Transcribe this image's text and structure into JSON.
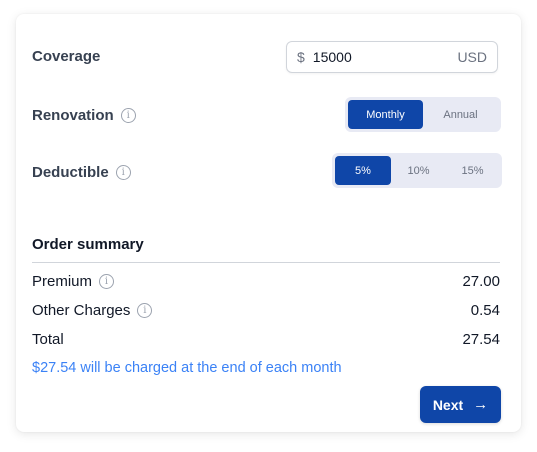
{
  "coverage": {
    "label": "Coverage",
    "prefix": "$",
    "value": "15000",
    "suffix": "USD"
  },
  "renovation": {
    "label": "Renovation",
    "options": [
      "Monthly",
      "Annual"
    ],
    "selected": "Monthly"
  },
  "deductible": {
    "label": "Deductible",
    "options": [
      "5%",
      "10%",
      "15%"
    ],
    "selected": "5%"
  },
  "summary": {
    "title": "Order summary",
    "premium_label": "Premium",
    "premium_value": "27.00",
    "other_label": "Other Charges",
    "other_value": "0.54",
    "total_label": "Total",
    "total_value": "27.54",
    "note": "$27.54 will be charged at the end of each month"
  },
  "actions": {
    "next_label": "Next",
    "next_icon": "arrow-right-icon"
  },
  "colors": {
    "accent": "#0f46a8",
    "note": "#3b82f6",
    "segment_bg": "#e8eaf4"
  }
}
